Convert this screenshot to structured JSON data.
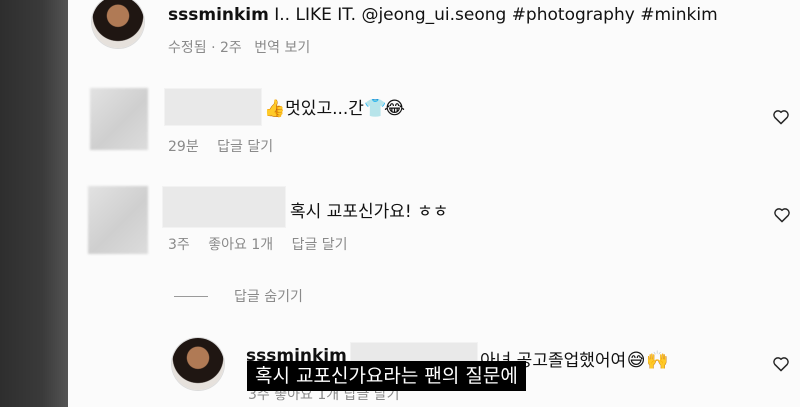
{
  "post": {
    "username": "sssminkim",
    "caption": "I.. LIKE IT. @jeong_ui.seong #photography #minkim",
    "meta": "수정됨 · 2주",
    "translate": "번역 보기"
  },
  "comments": [
    {
      "text": "👍멋있고...간",
      "emojis": [
        "shirt-icon",
        "laughing-emoji"
      ],
      "time": "29분",
      "reply": "답글 달기"
    },
    {
      "text": "혹시 교포신가요! ㅎㅎ",
      "time": "3주",
      "likes": "좋아요 1개",
      "reply": "답글 달기",
      "hide_replies": "답글 숨기기"
    }
  ],
  "reply": {
    "username": "sssminkim",
    "text": "아녀 공고졸업했어여",
    "emojis": [
      "grin-sweat-emoji",
      "raised-hands-emoji"
    ],
    "meta_partial": "3주  좋아요 1개  답글 달기"
  },
  "subtitle": "혹시 교포신가요라는 팬의 질문에"
}
